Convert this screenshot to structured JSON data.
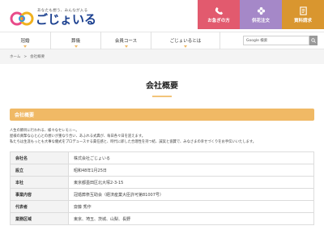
{
  "logo": {
    "tagline": "あなたも想う、みんなが入る",
    "name": "ごじょいる"
  },
  "top_buttons": [
    {
      "label": "お急ぎの方",
      "color": "#e25a6e",
      "icon": "phone-icon"
    },
    {
      "label": "供花注文",
      "color": "#a588c8",
      "icon": "flower-icon"
    },
    {
      "label": "資料請求",
      "color": "#d9962f",
      "icon": "document-icon"
    }
  ],
  "nav": {
    "items": [
      "冠婚",
      "葬儀",
      "会員コース",
      "ごじょいるとは"
    ],
    "search_placeholder": "Google 検索"
  },
  "breadcrumb": {
    "home": "ホーム",
    "separator": ">",
    "current": "会社概要"
  },
  "page_title": "会社概要",
  "section_title": "会社概要",
  "intro": {
    "line1": "人生の節目に行われる、様々なセレモニー。",
    "line2": "屋様の真摯な心と心との想いが重なり合い、あふれる式典が、毎日各々日を迎えます。",
    "line3": "私たちは生涯もっとも大事な儀式をプロデュースする責任感と、時代に即した合理性を持つ結、誠実と協賛で、みなさまの幸せづくりをお手伝いいたします。"
  },
  "table": [
    {
      "label": "会社名",
      "value": "株式会社ごじょいる"
    },
    {
      "label": "設立",
      "value": "昭和48年1月25日"
    },
    {
      "label": "本社",
      "value": "東京都墨田区北大塚2-3-15"
    },
    {
      "label": "事業内容",
      "value": "冠婚葬祭互助会（経済産業大臣許可第81007号）"
    },
    {
      "label": "代表者",
      "value": "齋藤 秀作"
    },
    {
      "label": "業務区域",
      "value": "東京、埼玉、茨城、山梨、長野"
    }
  ]
}
